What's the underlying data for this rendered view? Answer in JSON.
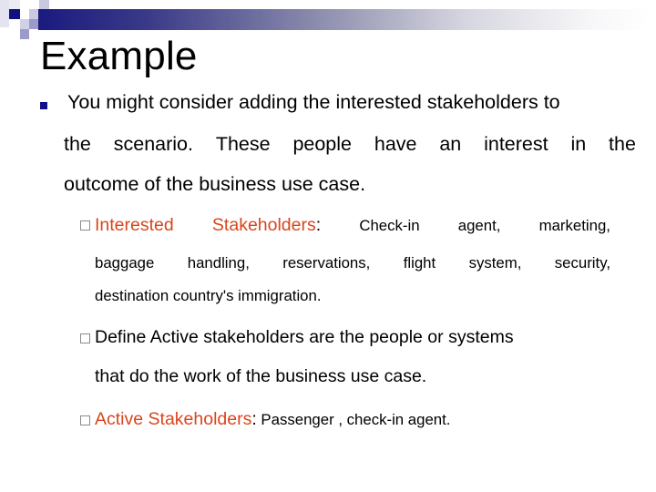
{
  "slide": {
    "title": "Example",
    "accent_color": "#1a1a80",
    "highlight_color": "#d8461e",
    "bullets": [
      {
        "level": 1,
        "icon": "filled-square-bullet",
        "lines": [
          "You might consider adding the interested stakeholders to",
          "the scenario. These people have an interest in the",
          "outcome of the business use case."
        ],
        "line_words": [
          [
            "You might consider adding the interested stakeholders to"
          ],
          [
            "the",
            "scenario.",
            "These",
            "people",
            "have",
            "an",
            "interest",
            "in",
            "the"
          ],
          [
            "outcome of the business use case."
          ]
        ]
      },
      {
        "level": 2,
        "icon": "hollow-square-bullet",
        "label": "Interested Stakeholders",
        "label_words": [
          "Interested",
          "Stakeholders"
        ],
        "separator": ":",
        "text": "Check-in agent, marketing, baggage handling, reservations, flight system, security, destination country's immigration.",
        "line_words": [
          [
            "Check-in",
            "agent,",
            "marketing,"
          ],
          [
            "baggage",
            "handling,",
            "reservations,",
            "flight",
            "system,",
            "security,"
          ],
          [
            "destination country's immigration."
          ]
        ]
      },
      {
        "level": 2,
        "icon": "hollow-square-bullet",
        "lines": [
          "Define Active stakeholders are the people or systems",
          "that do the work of the business use case."
        ]
      },
      {
        "level": 2,
        "icon": "hollow-square-bullet",
        "label": "Active Stakeholders",
        "separator": ":",
        "text": " Passenger , check-in agent."
      }
    ]
  }
}
